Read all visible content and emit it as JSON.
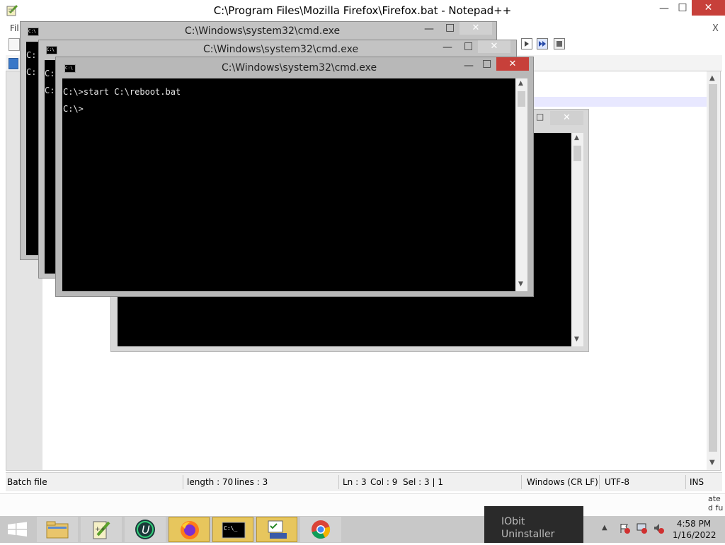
{
  "notepad": {
    "title": "C:\\Program Files\\Mozilla Firefox\\Firefox.bat - Notepad++",
    "menu_partial": "Fil",
    "close_doc": "X",
    "status": {
      "type": "Batch file",
      "length": "length : 70",
      "lines": "lines : 3",
      "ln": "Ln : 3",
      "col": "Col : 9",
      "sel": "Sel : 3 | 1",
      "eol": "Windows (CR LF)",
      "encoding": "UTF-8",
      "mode": "INS"
    }
  },
  "cmd_windows": [
    {
      "title": "C:\\Windows\\system32\\cmd.exe",
      "visible_prompts": [
        "C:",
        "C:"
      ]
    },
    {
      "title": "C:\\Windows\\system32\\cmd.exe",
      "visible_prompts": [
        "C:",
        "C:"
      ]
    },
    {
      "title": "C:\\Windows\\system32\\cmd.exe",
      "lines": [
        "C:\\>start C:\\reboot.bat",
        "C:\\>"
      ]
    }
  ],
  "background_text": {
    "iobit_1": "IObit",
    "iobit_2": "Uninstaller",
    "side_1": "ate",
    "side_2": "d fu"
  },
  "taskbar": {
    "apps": [
      {
        "name": "start-button",
        "icon": "windows-logo-icon"
      },
      {
        "name": "file-explorer",
        "icon": "folder-icon"
      },
      {
        "name": "notepad-plus-plus",
        "icon": "notepadpp-icon"
      },
      {
        "name": "iobit-uninstaller",
        "icon": "iobit-u-icon"
      },
      {
        "name": "firefox",
        "icon": "firefox-icon"
      },
      {
        "name": "command-prompt",
        "icon": "cmd-icon"
      },
      {
        "name": "task-scheduler",
        "icon": "scheduler-icon"
      },
      {
        "name": "chrome",
        "icon": "chrome-icon"
      }
    ],
    "tray": {
      "time": "4:58 PM",
      "date": "1/16/2022"
    }
  },
  "colors": {
    "taskbar": "#c8c8c8",
    "active_task": "#e7c65d",
    "close_red": "#c7403a",
    "console_bg": "#000000"
  }
}
